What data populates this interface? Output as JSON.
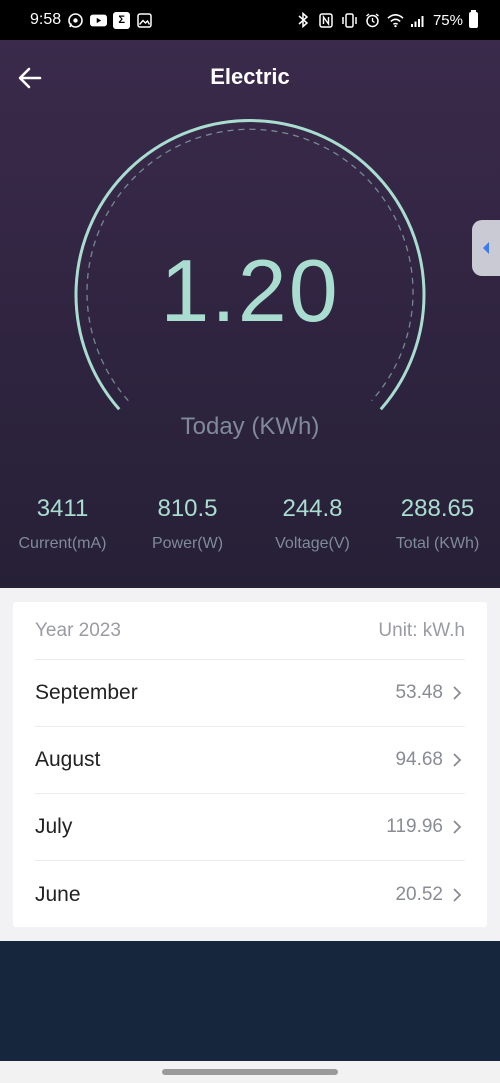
{
  "status_bar": {
    "time": "9:58",
    "battery": "75%",
    "left_icons": [
      "whatsapp-icon",
      "youtube-icon",
      "sigma-icon",
      "gallery-icon"
    ],
    "right_icons": [
      "bluetooth-icon",
      "nfc-icon",
      "vibrate-icon",
      "alarm-icon",
      "wifi-icon",
      "signal-icon",
      "battery-icon"
    ]
  },
  "header": {
    "title": "Electric",
    "back_icon": "back-arrow-icon"
  },
  "meter": {
    "value": "1.20",
    "label": "Today (KWh)"
  },
  "side_tab_icon": "caret-left-icon",
  "stats": [
    {
      "value": "3411",
      "label": "Current(mA)"
    },
    {
      "value": "810.5",
      "label": "Power(W)"
    },
    {
      "value": "244.8",
      "label": "Voltage(V)"
    },
    {
      "value": "288.65",
      "label": "Total (KWh)"
    }
  ],
  "monthly": {
    "year_label": "Year 2023",
    "unit_label": "Unit: kW.h",
    "rows": [
      {
        "month": "September",
        "value": "53.48"
      },
      {
        "month": "August",
        "value": "94.68"
      },
      {
        "month": "July",
        "value": "119.96"
      },
      {
        "month": "June",
        "value": "20.52"
      }
    ]
  },
  "colors": {
    "accent": "#a9ddd0",
    "muted": "#7f8a9a",
    "hero_top": "#3b2a4b",
    "hero_bottom": "#262036",
    "side_tab_arrow": "#3a7bf2",
    "footer": "#16263d"
  }
}
